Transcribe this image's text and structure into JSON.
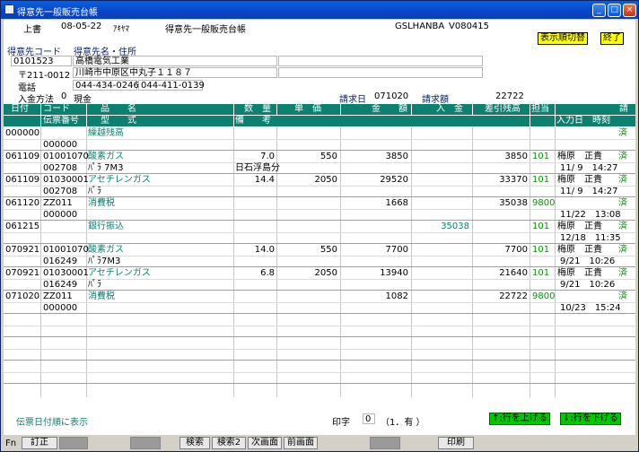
{
  "window": {
    "title": "得意先一般販売台帳"
  },
  "header": {
    "mode": "上書",
    "date": "08-05-22",
    "user": "ｱｷﾔﾏ",
    "title": "得意先一般販売台帳",
    "program": "GSLHANBA",
    "version": "V080415",
    "btn_toggle": "表示順切替",
    "btn_end": "終了"
  },
  "customer": {
    "code_label": "得意先コード",
    "name_label": "得意先名・住所",
    "code": "0101523",
    "name": "高橋電気工業",
    "zip": "〒211-0012",
    "address": "川崎市中原区中丸子１１８７",
    "phone_label": "電話",
    "phone1": "044-434-0246",
    "phone2": "044-411-0139",
    "payment_label": "入金方法",
    "payment_code": "0",
    "payment": "現金",
    "billing_date_label": "請求日",
    "billing_date": "071020",
    "billing_amount_label": "請求額",
    "billing_amount": "22722"
  },
  "columns": {
    "date": "日付",
    "code": "コード",
    "slip": "伝票番号",
    "item": "品　　名",
    "spec": "型　　式",
    "qty": "数　量",
    "note": "備　　考",
    "price": "単　価",
    "amount": "金　　額",
    "deposit": "入　金",
    "balance": "差引残高",
    "staff": "担当",
    "status": "請",
    "input": "入力日　時刻"
  },
  "rows": [
    {
      "date": "000000",
      "code": "",
      "item": "繰越残高",
      "slip": "000000",
      "spec": "",
      "qty": "",
      "note": "",
      "price": "",
      "amount": "",
      "deposit": "",
      "balance": "",
      "staff": "",
      "person": "",
      "status": "済",
      "input": ""
    },
    {
      "date": "061109",
      "code": "01001070",
      "item": "酸素ガス",
      "slip": "002708",
      "spec": "ﾊﾟﾗ 7M3",
      "qty": "7.0",
      "note": "日石浮島分",
      "price": "550",
      "amount": "3850",
      "deposit": "",
      "balance": "3850",
      "staff": "101",
      "person": "梅原　正貴",
      "status": "済",
      "input": "11/ 9　14:27"
    },
    {
      "date": "061109",
      "code": "01030001",
      "item": "アセチレンガス",
      "slip": "002708",
      "spec": "ﾊﾟﾗ",
      "qty": "14.4",
      "note": "",
      "price": "2050",
      "amount": "29520",
      "deposit": "",
      "balance": "33370",
      "staff": "101",
      "person": "梅原　正貴",
      "status": "済",
      "input": "11/ 9　14:27"
    },
    {
      "date": "061120",
      "code": "ZZ011",
      "item": "消費税",
      "slip": "000000",
      "spec": "",
      "qty": "",
      "note": "",
      "price": "",
      "amount": "1668",
      "deposit": "",
      "balance": "35038",
      "staff": "9800",
      "person": "",
      "status": "済",
      "input": "11/22　13:08"
    },
    {
      "date": "061215",
      "code": "",
      "item": "銀行振込",
      "slip": "",
      "spec": "",
      "qty": "",
      "note": "",
      "price": "",
      "amount": "",
      "deposit": "35038",
      "balance": "",
      "staff": "101",
      "person": "梅原　正貴",
      "status": "済",
      "input": "12/18　11:35"
    },
    {
      "date": "070921",
      "code": "01001070",
      "item": "酸素ガス",
      "slip": "016249",
      "spec": "ﾊﾟﾗ7M3",
      "qty": "14.0",
      "note": "",
      "price": "550",
      "amount": "7700",
      "deposit": "",
      "balance": "7700",
      "staff": "101",
      "person": "梅原　正貴",
      "status": "済",
      "input": "9/21　10:26"
    },
    {
      "date": "070921",
      "code": "01030001",
      "item": "アセチレンガス",
      "slip": "016249",
      "spec": "ﾊﾟﾗ",
      "qty": "6.8",
      "note": "",
      "price": "2050",
      "amount": "13940",
      "deposit": "",
      "balance": "21640",
      "staff": "101",
      "person": "梅原　正貴",
      "status": "済",
      "input": "9/21　10:26"
    },
    {
      "date": "071020",
      "code": "ZZ011",
      "item": "消費税",
      "slip": "000000",
      "spec": "",
      "qty": "",
      "note": "",
      "price": "",
      "amount": "1082",
      "deposit": "",
      "balance": "22722",
      "staff": "9800",
      "person": "",
      "status": "済",
      "input": "10/23　15:24"
    }
  ],
  "footer": {
    "order_note": "伝票日付順に表示",
    "print_label": "印字",
    "print_value": "0",
    "print_hint": "（1．有 ）",
    "btn_up": "↑:行を上げる",
    "btn_down": "↓:行を下げる"
  },
  "fkeys": {
    "fn": "Fn",
    "f1": "訂正",
    "f5": "検索",
    "f6": "検索2",
    "f7": "次画面",
    "f8": "前画面",
    "f12": "印刷"
  }
}
